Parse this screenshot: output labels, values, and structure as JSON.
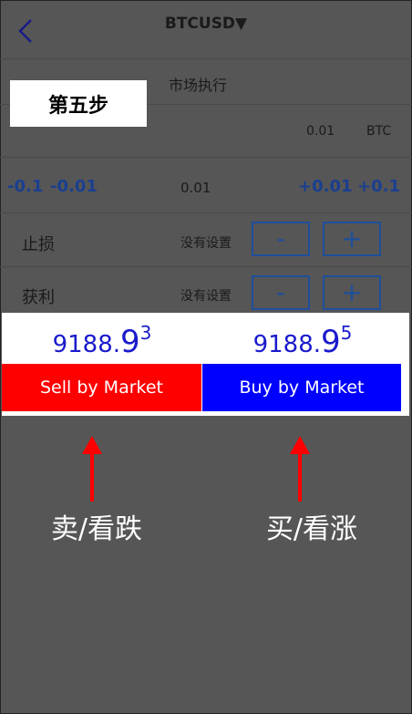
{
  "header": {
    "title": "BTCUSD▼",
    "back_icon": "chevron-left-icon"
  },
  "execution": {
    "label": "市场执行"
  },
  "step_label": "第五步",
  "volume": {
    "value": "0.01",
    "unit": "BTC"
  },
  "adjust": {
    "minus_1": "-0.1",
    "minus_2": "-0.01",
    "current": "0.01",
    "plus_1": "+0.01",
    "plus_2": "+0.1"
  },
  "stop_loss": {
    "label": "止损",
    "status": "没有设置",
    "minus": "-",
    "plus": "+"
  },
  "take_profit": {
    "label": "获利",
    "status": "没有设置",
    "minus": "-",
    "plus": "+"
  },
  "prices": {
    "sell": {
      "main": "9188.",
      "big": "9",
      "sup": "3"
    },
    "buy": {
      "main": "9188.",
      "big": "9",
      "sup": "5"
    }
  },
  "buttons": {
    "sell_label": "Sell by Market",
    "buy_label": "Buy by Market"
  },
  "annotations": {
    "sell": "卖/看跌",
    "buy": "买/看涨"
  },
  "colors": {
    "sell": "#ff0000",
    "buy": "#0000ff",
    "arrow": "#ff0000",
    "overlay": "#565656"
  }
}
